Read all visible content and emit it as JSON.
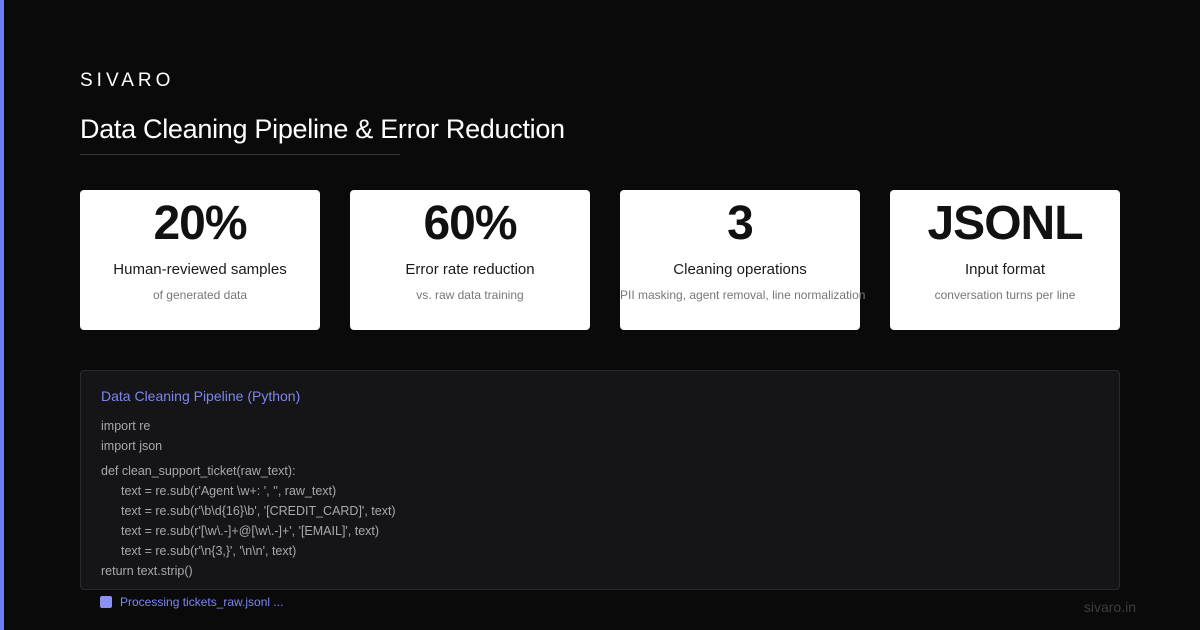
{
  "brand": "SIVARO",
  "title": "Data Cleaning Pipeline & Error Reduction",
  "stats": [
    {
      "value": "20%",
      "label": "Human-reviewed samples",
      "sub": "of generated data"
    },
    {
      "value": "60%",
      "label": "Error rate reduction",
      "sub": "vs. raw data training"
    },
    {
      "value": "3",
      "label": "Cleaning operations",
      "sub": "PII masking, agent removal, line normalization"
    },
    {
      "value": "JSONL",
      "label": "Input format",
      "sub": "conversation turns per line"
    }
  ],
  "code": {
    "title": "Data Cleaning Pipeline (Python)",
    "lines": [
      "import re",
      "import json",
      "def clean_support_ticket(raw_text):",
      "text = re.sub(r'Agent \\w+: ', '', raw_text)",
      "text = re.sub(r'\\b\\d{16}\\b', '[CREDIT_CARD]', text)",
      "text = re.sub(r'[\\w\\.-]+@[\\w\\.-]+', '[EMAIL]', text)",
      "text = re.sub(r'\\n{3,}', '\\n\\n', text)",
      "return text.strip()"
    ]
  },
  "status": "Processing tickets_raw.jsonl ...",
  "footer_url": "sivaro.in",
  "colors": {
    "accent": "#6f7cf2",
    "background": "#0a0a0b",
    "card": "#ffffff"
  }
}
